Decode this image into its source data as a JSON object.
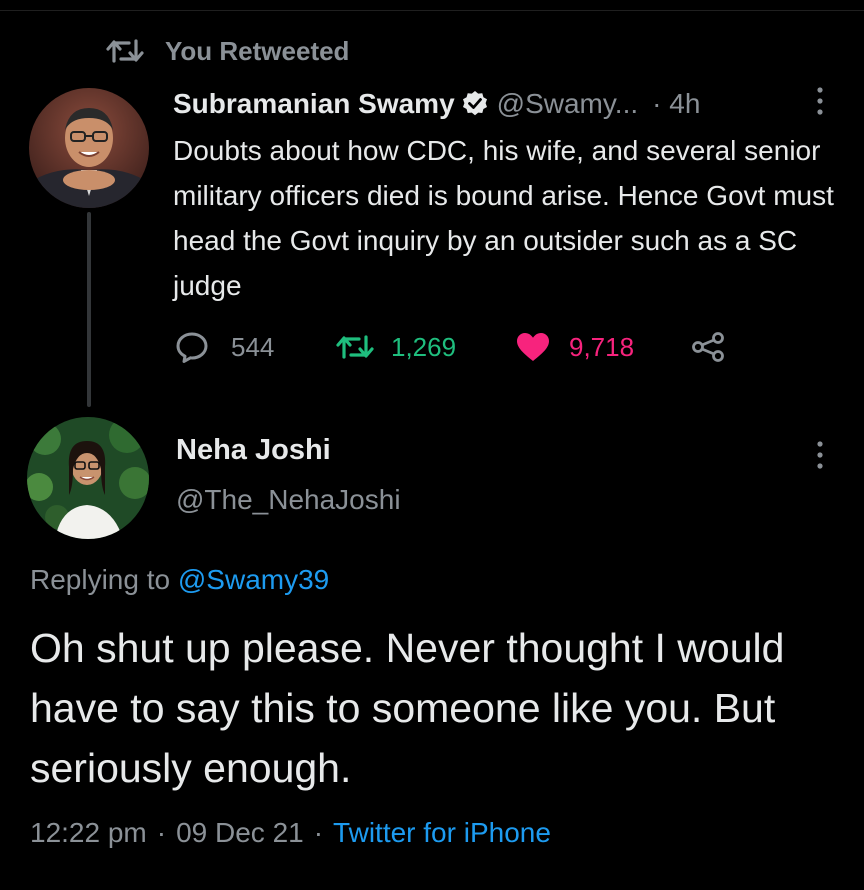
{
  "retweet_header": {
    "label": "You Retweeted"
  },
  "original_tweet": {
    "name": "Subramanian Swamy",
    "handle": "@Swamy...",
    "time": "· 4h",
    "text": "Doubts about how CDC, his wife, and several senior military officers died is bound arise. Hence Govt must head the Govt inquiry by an outsider such as a SC judge",
    "replies": "544",
    "retweets": "1,269",
    "likes": "9,718"
  },
  "reply_tweet": {
    "name": "Neha Joshi",
    "handle": "@The_NehaJoshi",
    "replying_prefix": "Replying to",
    "replying_to": "@Swamy39",
    "text": "Oh shut up please. Never thought I would have to say this to someone like you. But seriously enough.",
    "time": "12:22 pm",
    "date": "09 Dec 21",
    "source": "Twitter for iPhone",
    "separator": "·"
  },
  "colors": {
    "background": "#000000",
    "text": "#e7e9ea",
    "secondary": "#8b9197",
    "link": "#1d9bf0",
    "retweet": "#1fbe7e",
    "like": "#f7237d"
  },
  "icons": [
    "retweet-icon",
    "verified-badge-icon",
    "more-icon",
    "reply-icon",
    "heart-icon",
    "share-icon"
  ]
}
